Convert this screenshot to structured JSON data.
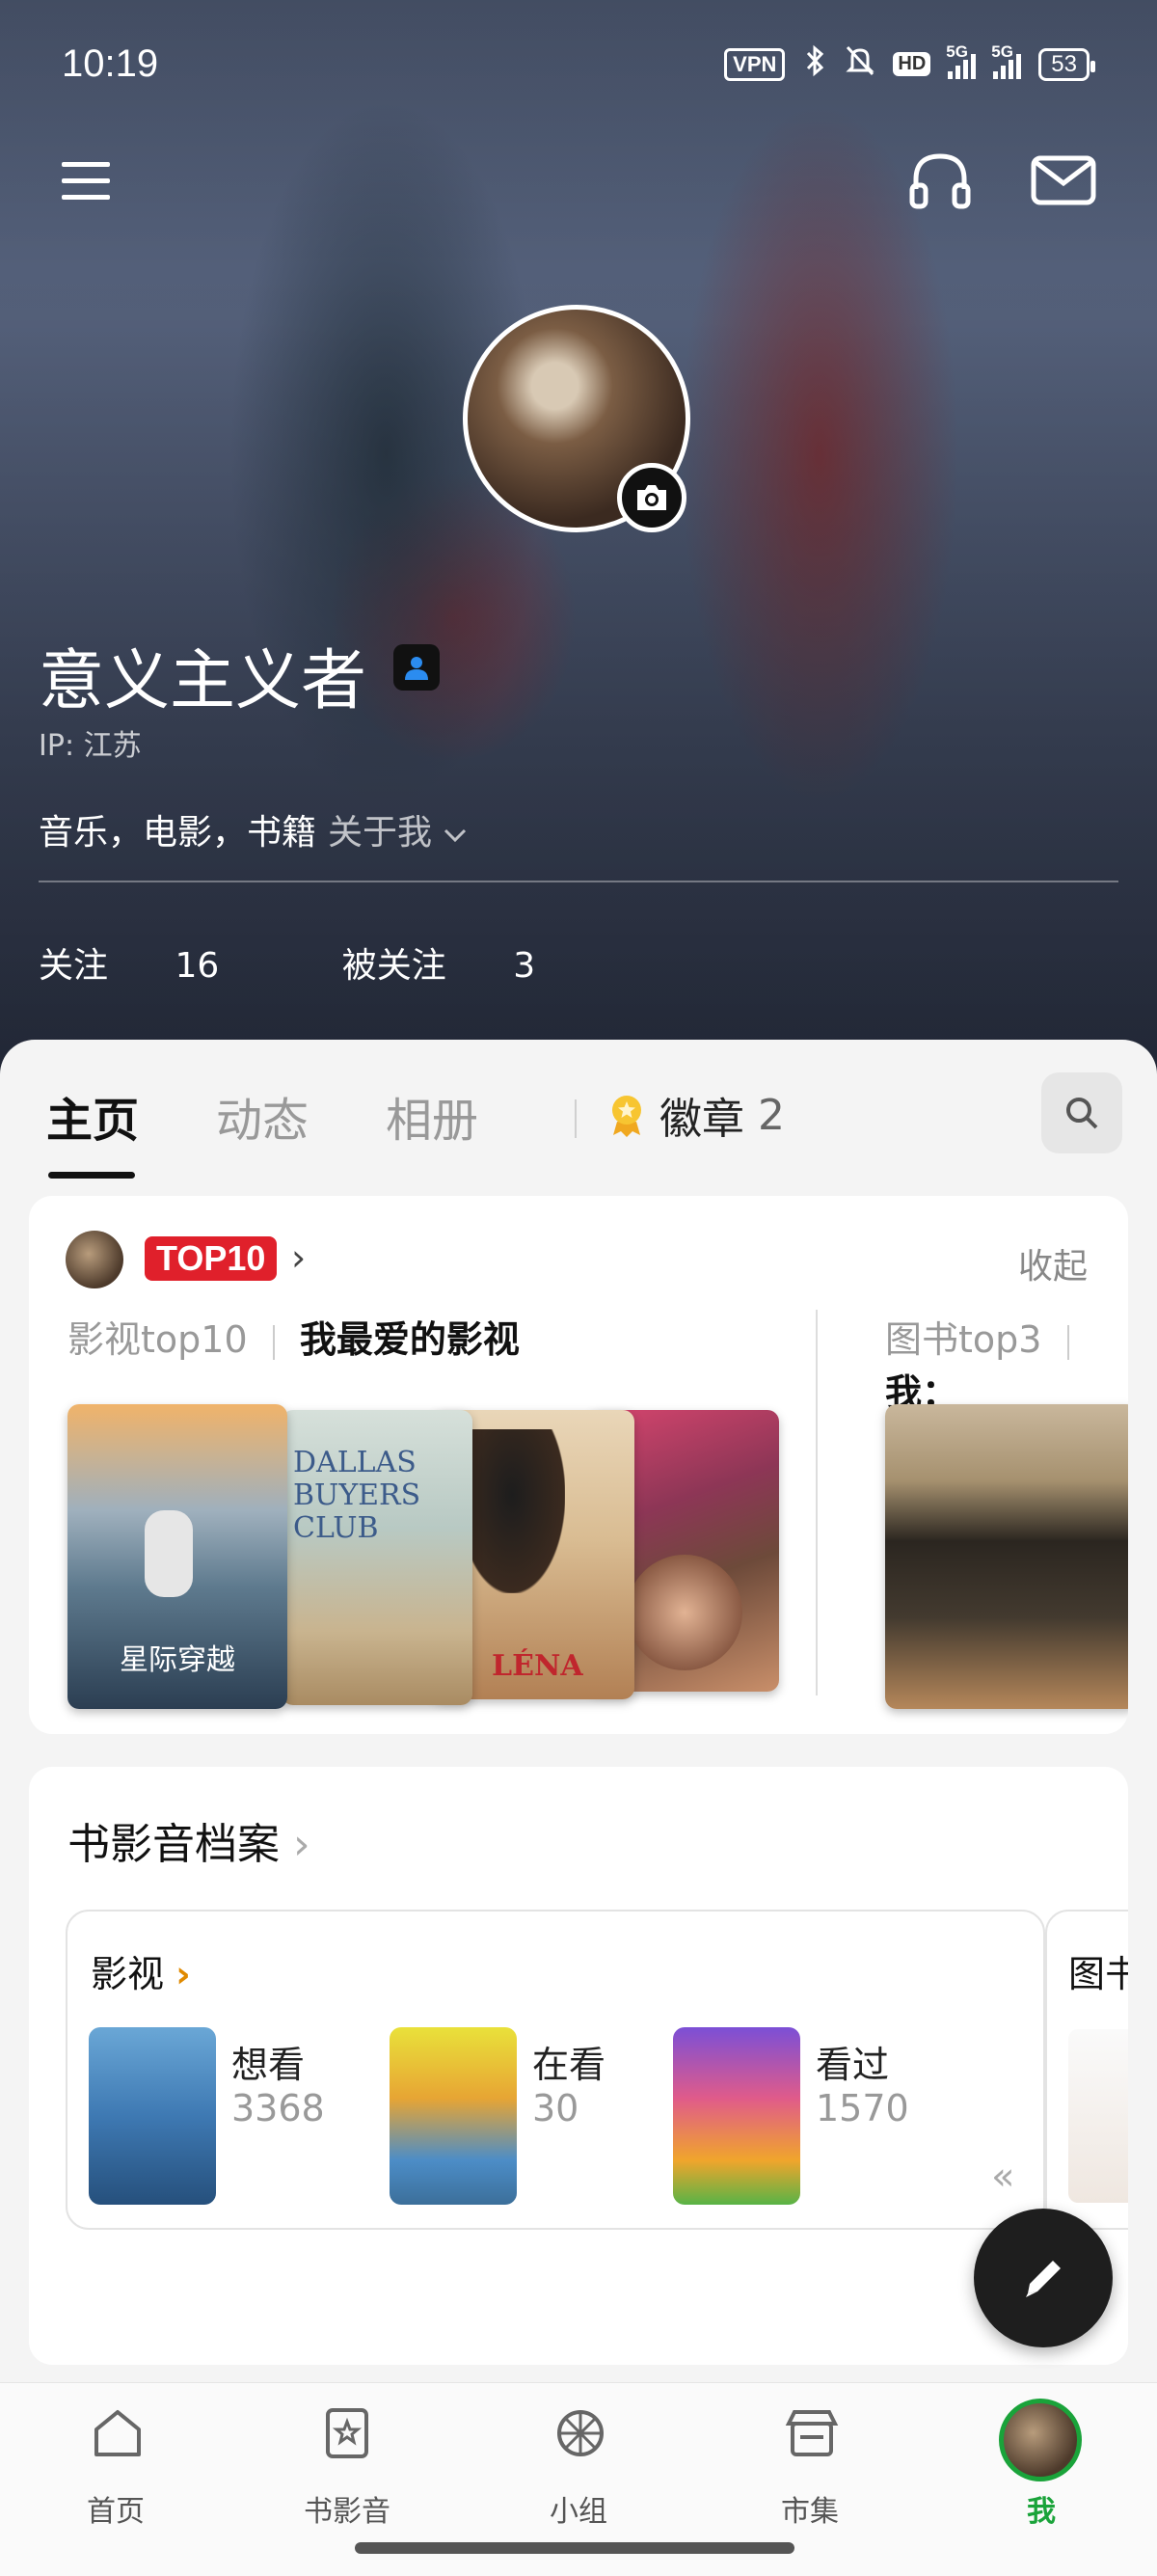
{
  "status_bar": {
    "time": "10:19",
    "vpn": "VPN",
    "hd": "HD",
    "signal1": "5G",
    "signal2": "5G",
    "battery": "53"
  },
  "header": {
    "menu_icon": "menu-icon",
    "headphones_icon": "headphones-icon",
    "mail_icon": "mail-icon"
  },
  "profile": {
    "username": "意义主义者",
    "ip": "IP: 江苏",
    "interests": "音乐，电影，书籍",
    "about": "关于我",
    "following_label": "关注",
    "following_count": "16",
    "followers_label": "被关注",
    "followers_count": "3"
  },
  "tabs": {
    "items": [
      "主页",
      "动态",
      "相册"
    ],
    "badge_label": "徽章",
    "badge_count": "2"
  },
  "top10_card": {
    "badge": "TOP10",
    "collapse": "收起",
    "list1_label": "影视top10",
    "list1_title": "我最爱的影视",
    "list2_label": "图书top3",
    "list2_title": "我：",
    "posters": {
      "p1_title": "星际穿越",
      "p2_title": "DALLAS BUYERS CLUB",
      "p3_title": "LÉNA"
    }
  },
  "archive": {
    "title": "书影音档案",
    "movies_title": "影视",
    "books_title": "图书",
    "stats": [
      {
        "label": "想看",
        "count": "3368"
      },
      {
        "label": "在看",
        "count": "30"
      },
      {
        "label": "看过",
        "count": "1570"
      }
    ]
  },
  "bottom_nav": {
    "items": [
      "首页",
      "书影音",
      "小组",
      "市集",
      "我"
    ]
  },
  "colors": {
    "accent_green": "#1aa33a",
    "top10_red": "#e0202b",
    "link_orange": "#e08a00"
  }
}
